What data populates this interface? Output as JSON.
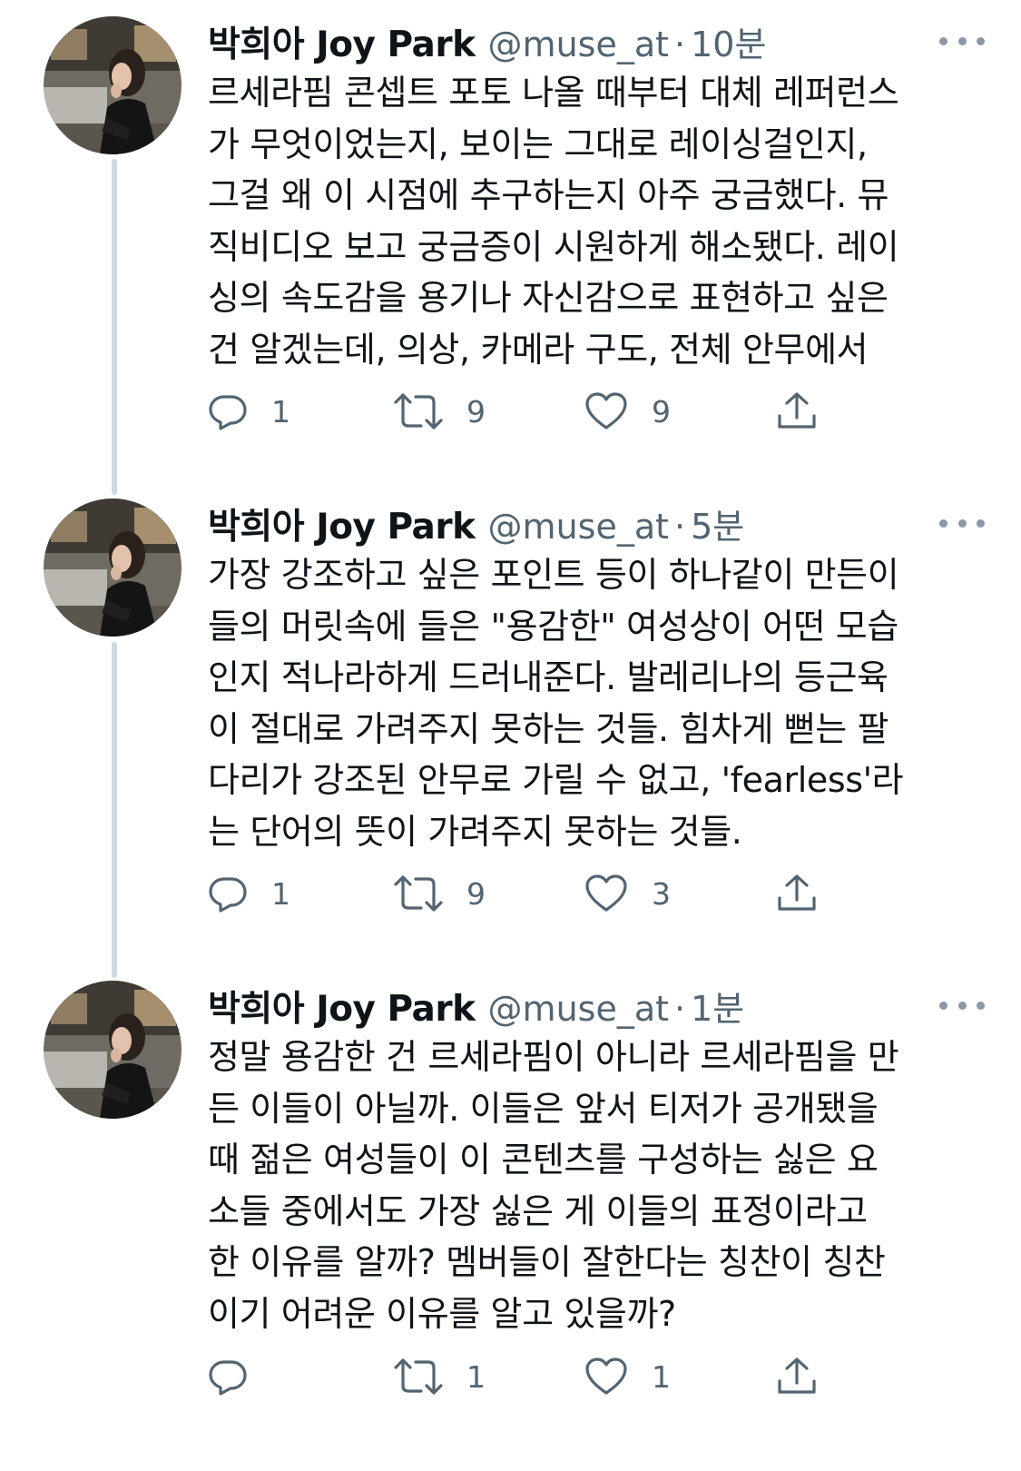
{
  "tweets": [
    {
      "author_name": "박희아 Joy Park",
      "handle": "@muse_at",
      "separator": "·",
      "time": "10분",
      "text": "르세라핌 콘셉트 포토 나올 때부터 대체 레퍼런스\n가 무엇이었는지, 보이는 그대로 레이싱걸인지,\n그걸 왜 이 시점에 추구하는지 아주 궁금했다. 뮤\n직비디오 보고 궁금증이 시원하게 해소됐다. 레이\n싱의 속도감을 용기나 자신감으로 표현하고 싶은\n건 알겠는데, 의상, 카메라 구도, 전체 안무에서",
      "replies": "1",
      "retweets": "9",
      "likes": "9"
    },
    {
      "author_name": "박희아 Joy Park",
      "handle": "@muse_at",
      "separator": "·",
      "time": "5분",
      "text": "가장 강조하고 싶은 포인트 등이 하나같이 만든이\n들의 머릿속에 들은 \"용감한\" 여성상이 어떤 모습\n인지 적나라하게 드러내준다. 발레리나의 등근육\n이 절대로 가려주지 못하는 것들. 힘차게 뻗는 팔\n다리가 강조된 안무로 가릴 수 없고, 'fearless'라\n는 단어의 뜻이 가려주지 못하는 것들.",
      "replies": "1",
      "retweets": "9",
      "likes": "3"
    },
    {
      "author_name": "박희아 Joy Park",
      "handle": "@muse_at",
      "separator": "·",
      "time": "1분",
      "text": "정말 용감한 건 르세라핌이 아니라 르세라핌을 만\n든 이들이 아닐까. 이들은 앞서 티저가 공개됐을\n때 젊은 여성들이 이 콘텐츠를 구성하는 싫은 요\n소들 중에서도 가장 싫은 게 이들의 표정이라고\n한 이유를 알까? 멤버들이 잘한다는 칭찬이 칭찬\n이기 어려운 이유를 알고 있을까?",
      "replies": "",
      "retweets": "1",
      "likes": "1"
    }
  ],
  "icons": {
    "reply": "reply-icon",
    "retweet": "retweet-icon",
    "like": "heart-icon",
    "share": "share-icon",
    "more": "more-options-icon"
  },
  "colors": {
    "text": "#0f1419",
    "secondary": "#536471",
    "thread_line": "#cfd9de"
  }
}
